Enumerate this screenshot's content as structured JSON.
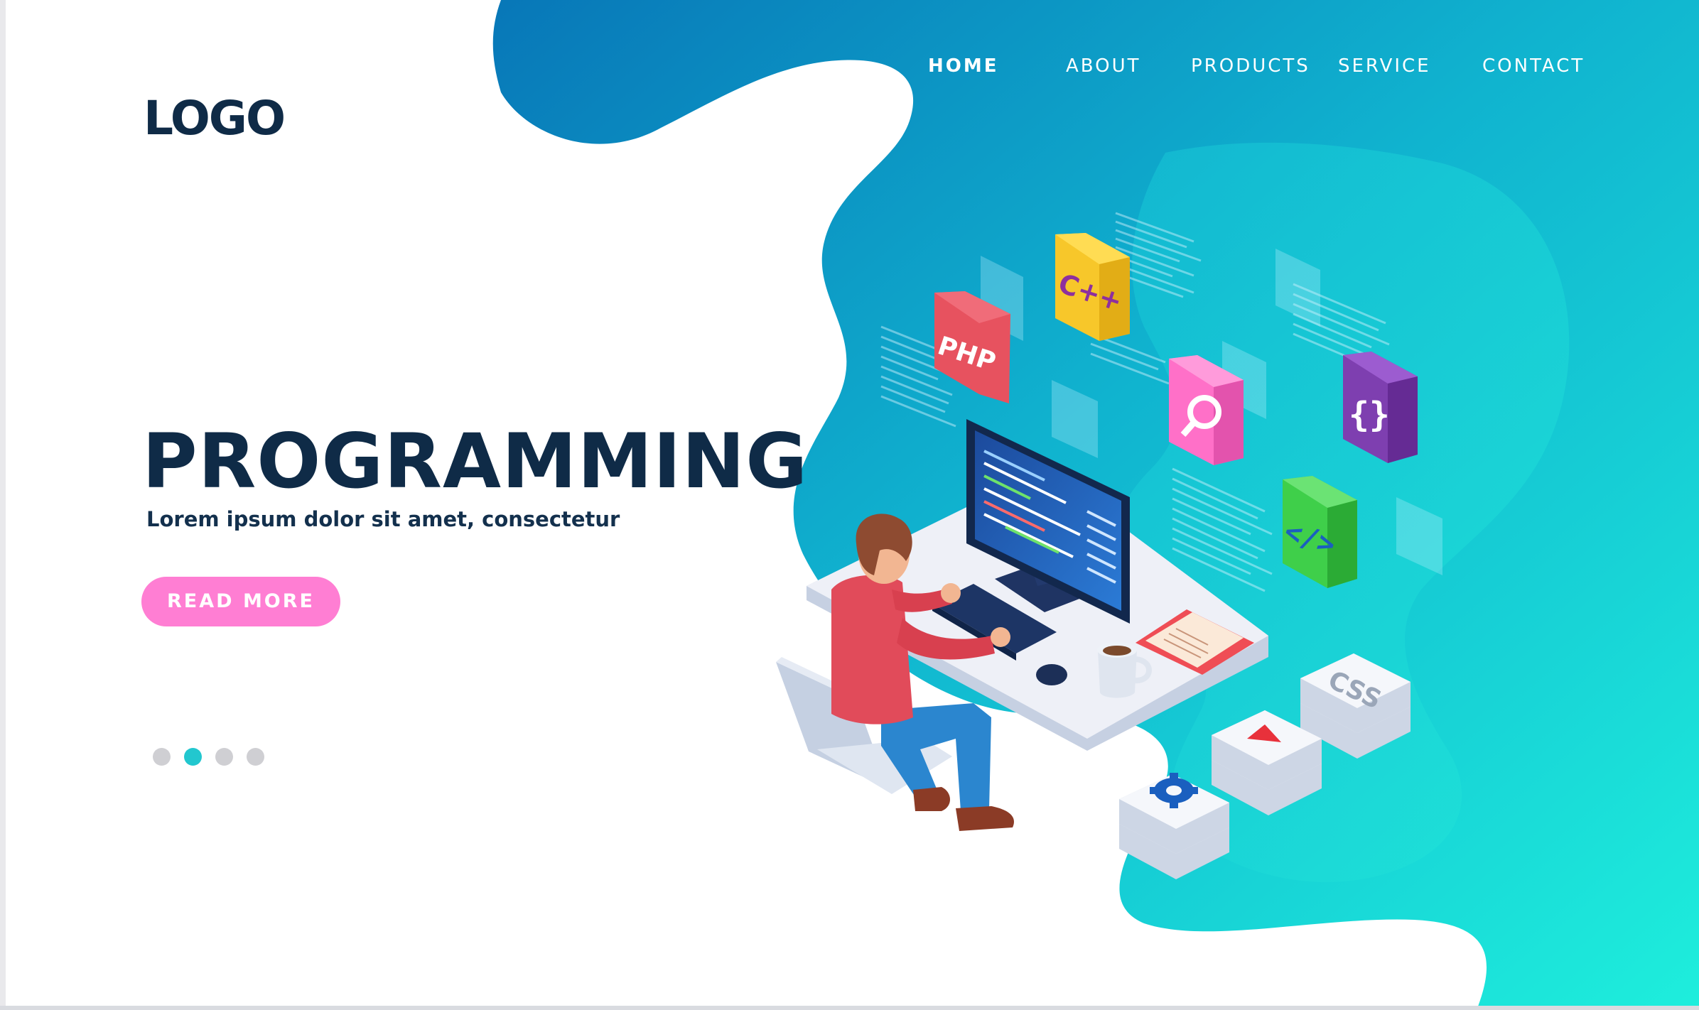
{
  "header": {
    "logo": "LOGO",
    "nav": [
      {
        "label": "HOME",
        "active": true
      },
      {
        "label": "ABOUT",
        "active": false
      },
      {
        "label": "PRODUCTS",
        "active": false
      },
      {
        "label": "SERVICE",
        "active": false
      },
      {
        "label": "CONTACT",
        "active": false
      }
    ]
  },
  "hero": {
    "title": "PROGRAMMING",
    "subtitle": "Lorem ipsum dolor sit amet, consectetur",
    "cta_label": "READ MORE"
  },
  "carousel": {
    "slide_count": 4,
    "active_index": 1
  },
  "illustration": {
    "subject": "developer-at-computer-icon",
    "tiles": [
      "PHP",
      "C++",
      "{ }",
      "</>",
      "CSS"
    ],
    "icons": [
      "php-icon",
      "cpp-icon",
      "search-icon",
      "braces-icon",
      "code-icon",
      "css-icon",
      "play-icon",
      "gear-icon"
    ]
  },
  "colors": {
    "gradient_dark": "#0a7bbd",
    "gradient_light": "#1de6d6",
    "text_dark": "#0f2b47",
    "cta": "#ff7ed3",
    "dot_active": "#22c7cf",
    "dot_inactive": "#cfcfd3"
  }
}
